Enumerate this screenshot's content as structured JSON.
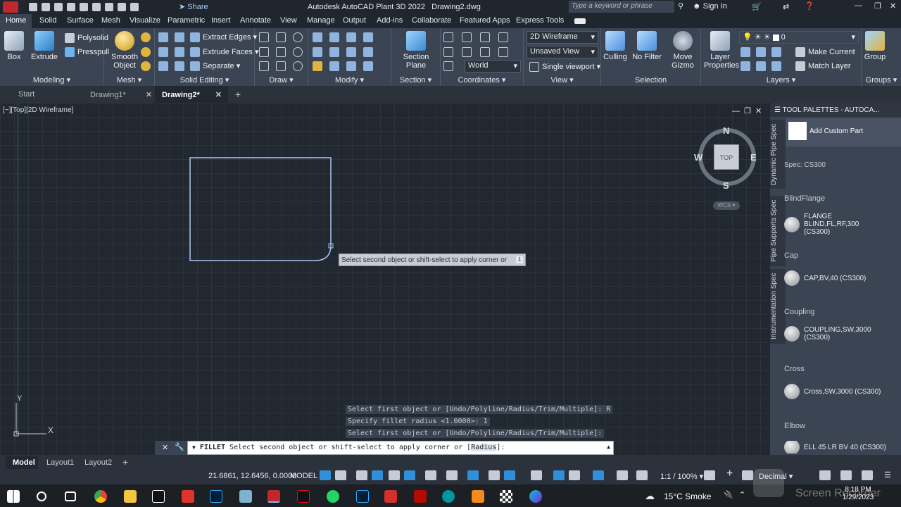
{
  "titlebar": {
    "share": "Share",
    "title": "Autodesk AutoCAD Plant 3D 2022",
    "file": "Drawing2.dwg",
    "search_placeholder": "Type a keyword or phrase",
    "sign_in": "Sign In"
  },
  "ribbon_tabs": [
    "Home",
    "Solid",
    "Surface",
    "Mesh",
    "Visualize",
    "Parametric",
    "Insert",
    "Annotate",
    "View",
    "Manage",
    "Output",
    "Add-ins",
    "Collaborate",
    "Featured Apps",
    "Express Tools"
  ],
  "ribbon": {
    "modeling": {
      "label": "Modeling",
      "box": "Box",
      "extrude": "Extrude",
      "polysolid": "Polysolid",
      "presspull": "Presspull"
    },
    "mesh": {
      "label": "Mesh",
      "smooth_object": "Smooth\nObject"
    },
    "solid_editing": {
      "label": "Solid Editing",
      "extract_edges": "Extract Edges",
      "extrude_faces": "Extrude Faces",
      "separate": "Separate"
    },
    "draw": {
      "label": "Draw"
    },
    "modify": {
      "label": "Modify"
    },
    "section": {
      "label": "Section",
      "section_plane": "Section\nPlane"
    },
    "coordinates": {
      "label": "Coordinates",
      "world": "World"
    },
    "view": {
      "label": "View",
      "visual_style": "2D Wireframe",
      "saved_view": "Unsaved View",
      "viewport": "Single viewport"
    },
    "selection": {
      "label": "Selection",
      "culling": "Culling",
      "no_filter": "No Filter",
      "move_gizmo": "Move\nGizmo"
    },
    "layers": {
      "label": "Layers",
      "layer_properties": "Layer\nProperties",
      "current_layer": "0",
      "make_current": "Make Current",
      "match_layer": "Match Layer"
    },
    "groups": {
      "label": "Groups",
      "group": "Group"
    }
  },
  "doc_tabs": [
    {
      "label": "Start"
    },
    {
      "label": "Drawing1*"
    },
    {
      "label": "Drawing2*"
    }
  ],
  "viewport": {
    "label": "[−][Top][2D Wireframe]",
    "tooltip": "Select second object or shift-select to apply corner or",
    "viewcube": {
      "n": "N",
      "s": "S",
      "e": "E",
      "w": "W",
      "top": "TOP",
      "wcs": "WCS"
    },
    "ucs": {
      "x": "X",
      "y": "Y"
    }
  },
  "command_history": [
    "Select first object or [Undo/Polyline/Radius/Trim/Multiple]: R",
    "Specify fillet radius <1.0000>: 1",
    "Select first object or [Undo/Polyline/Radius/Trim/Multiple]:"
  ],
  "command_line": {
    "command": "FILLET",
    "prompt": "Select second object or shift-select to apply corner or [",
    "option": "Radius",
    "suffix": "]:"
  },
  "palette": {
    "title": "TOOL PALETTES - AUTOCA...",
    "vtabs": [
      "Dynamic Pipe Spec",
      "Pipe Supports Spec",
      "Instrumentation Spec"
    ],
    "add_custom": "Add Custom Part",
    "spec": "Spec: CS300",
    "categories": [
      {
        "name": "BlindFlange",
        "item": "FLANGE BLIND,FL,RF,300\n(CS300)"
      },
      {
        "name": "Cap",
        "item": "CAP,BV,40 (CS300)"
      },
      {
        "name": "Coupling",
        "item": "COUPLING,SW,3000\n(CS300)"
      },
      {
        "name": "Cross",
        "item": "Cross,SW,3000 (CS300)"
      },
      {
        "name": "Elbow",
        "item": "ELL 45 LR BV 40 (CS300)"
      }
    ]
  },
  "layout_tabs": [
    "Model",
    "Layout1",
    "Layout2"
  ],
  "status": {
    "coords": "21.6861, 12.6456, 0.0000",
    "model": "MODEL",
    "scale": "1:1 / 100%",
    "units": "Decimal"
  },
  "taskbar": {
    "weather": "15°C  Smoke",
    "time": "8:18 PM",
    "date": "1/29/2023"
  },
  "watermark": "Screen Recorder",
  "colors": {
    "accent": "#0696d7",
    "rect_stroke": "#a9c8f3",
    "ribbon": "#3b4453",
    "canvas": "#212830"
  }
}
